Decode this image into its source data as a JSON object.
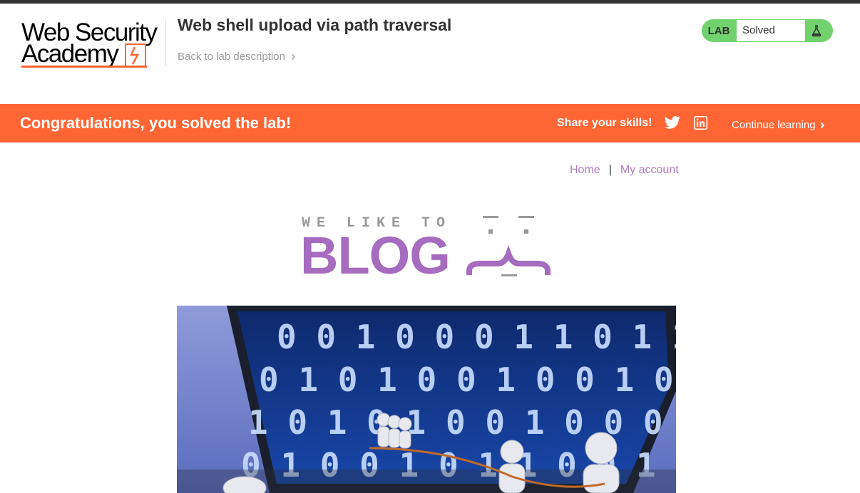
{
  "header": {
    "logo_line1": "Web Security",
    "logo_line2": "Academy",
    "lab_title": "Web shell upload via path traversal",
    "back_link": "Back to lab description",
    "lab_status_label": "LAB",
    "lab_status_value": "Solved"
  },
  "banner": {
    "message": "Congratulations, you solved the lab!",
    "share_label": "Share your skills!",
    "continue_label": "Continue learning"
  },
  "blog_nav": {
    "home": "Home",
    "separator": "|",
    "my_account": "My account"
  },
  "blog_banner": {
    "tagline": "WE LIKE TO",
    "title": "BLOG"
  },
  "colors": {
    "accent_orange": "#ff6633",
    "solved_green": "#70d16d",
    "link_purple": "#b07ec4",
    "blog_purple": "#a56cbf"
  },
  "icons": {
    "back": "double-chevron-right-icon",
    "flask": "flask-icon",
    "twitter": "twitter-icon",
    "linkedin": "linkedin-icon",
    "continue": "double-chevron-right-icon"
  }
}
